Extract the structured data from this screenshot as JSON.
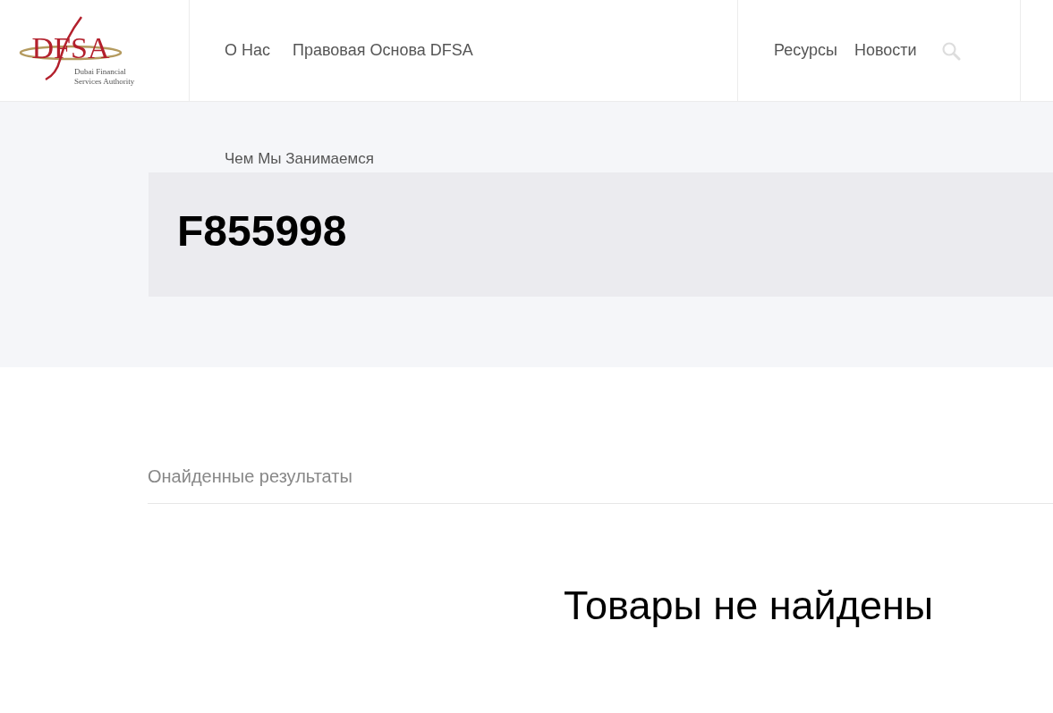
{
  "logo": {
    "mark": "DFSA",
    "subtitle_lines": [
      "Dubai Financial",
      "Services Authority"
    ]
  },
  "nav": {
    "left": [
      "О Нас",
      "Правовая Основа DFSA"
    ],
    "right": [
      "Ресурсы",
      "Новости"
    ]
  },
  "hero": {
    "breadcrumb": "Чем Мы Занимаемся",
    "title": "F855998"
  },
  "results": {
    "label": "Онайденные результаты",
    "empty_message": "Товары не найдены"
  }
}
